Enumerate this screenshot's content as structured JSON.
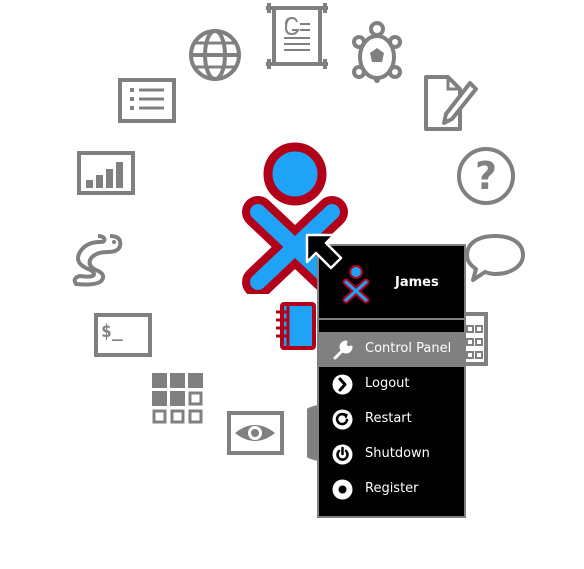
{
  "ring_icons": [
    {
      "name": "write-document-icon"
    },
    {
      "name": "turtle-icon"
    },
    {
      "name": "browse-globe-icon"
    },
    {
      "name": "list-icon"
    },
    {
      "name": "pencil-note-icon"
    },
    {
      "name": "bar-chart-icon"
    },
    {
      "name": "help-icon"
    },
    {
      "name": "snake-icon"
    },
    {
      "name": "speech-bubble-icon"
    },
    {
      "name": "terminal-icon"
    },
    {
      "name": "calculator-icon"
    },
    {
      "name": "memorize-grid-icon"
    },
    {
      "name": "eye-icon"
    }
  ],
  "terminal": {
    "prompt": "$_"
  },
  "colors": {
    "xo_stroke": "#b2001b",
    "xo_fill": "#1ea3f7",
    "icon_gray": "#808080",
    "palette_bg": "#000000",
    "palette_active": "#808080"
  },
  "user_palette": {
    "name": "James",
    "items": [
      {
        "label": "Control Panel",
        "icon": "wrench-icon",
        "active": true
      },
      {
        "label": "Logout",
        "icon": "logout-arrow-icon",
        "active": false
      },
      {
        "label": "Restart",
        "icon": "restart-icon",
        "active": false
      },
      {
        "label": "Shutdown",
        "icon": "power-icon",
        "active": false
      },
      {
        "label": "Register",
        "icon": "register-dot-icon",
        "active": false
      }
    ]
  }
}
